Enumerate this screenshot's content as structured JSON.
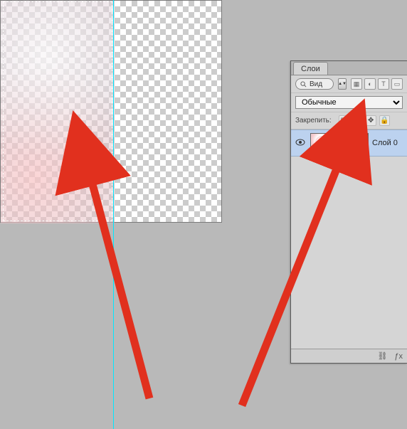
{
  "panel": {
    "tabs": {
      "layers_label": "Слои"
    },
    "search": {
      "label": "Вид"
    },
    "blend_mode": "Обычные",
    "lock_label": "Закрепить:"
  },
  "layer": {
    "name": "Слой 0"
  },
  "icons": {
    "eye": "eye-icon",
    "link": "chain-link-icon",
    "search": "magnifier-icon",
    "lock_pixels": "checker-icon",
    "lock_brush": "brush-icon",
    "lock_move": "move-icon",
    "lock_all": "lock-icon"
  }
}
